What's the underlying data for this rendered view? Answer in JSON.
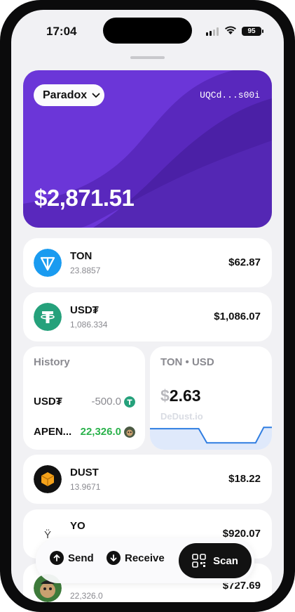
{
  "status_bar": {
    "time": "17:04",
    "battery": "95"
  },
  "wallet_card": {
    "wallet_name": "Paradox",
    "address": "UQCd...s00i",
    "total_balance": "$2,871.51",
    "background_color": "#6b36d8"
  },
  "tokens_top": [
    {
      "symbol": "TON",
      "amount": "23.8857",
      "value": "$62.87",
      "icon": "ton-icon",
      "color": "#1a9bf0"
    },
    {
      "symbol": "USD₮",
      "amount": "1,086.334",
      "value": "$1,086.07",
      "icon": "usdt-icon",
      "color": "#25a17b"
    }
  ],
  "history": {
    "title": "History",
    "rows": [
      {
        "symbol": "USD₮",
        "amount": "-500.0",
        "color": "#8a8a90",
        "icon": "usdt-icon"
      },
      {
        "symbol": "APEN...",
        "amount": "22,326.0",
        "color": "#2ab24b",
        "icon": "apen-avatar-icon"
      }
    ]
  },
  "price_tile": {
    "pair": "TON • USD",
    "currency_symbol": "$",
    "price": "2.63",
    "source": "DeDust.io",
    "sparkline": [
      0.55,
      0.55,
      0.55,
      0.55,
      0.55,
      0.55,
      0.55,
      0.02,
      0.02,
      0.02,
      0.02,
      0.02,
      0.02,
      0.02,
      0.6,
      0.6
    ]
  },
  "tokens_bottom": [
    {
      "symbol": "DUST",
      "amount": "13.9671",
      "value": "$18.22",
      "icon": "dust-icon",
      "color": "#f5a21a"
    },
    {
      "symbol": "YO",
      "amount": "",
      "value": "$920.07",
      "icon": "yo-icon",
      "color": "#111111"
    },
    {
      "symbol": "",
      "amount": "22,326.0",
      "value": "$727.69",
      "icon": "apen-avatar-icon",
      "color": "#3d7a3a"
    }
  ],
  "actions": {
    "send": "Send",
    "receive": "Receive",
    "scan": "Scan"
  }
}
